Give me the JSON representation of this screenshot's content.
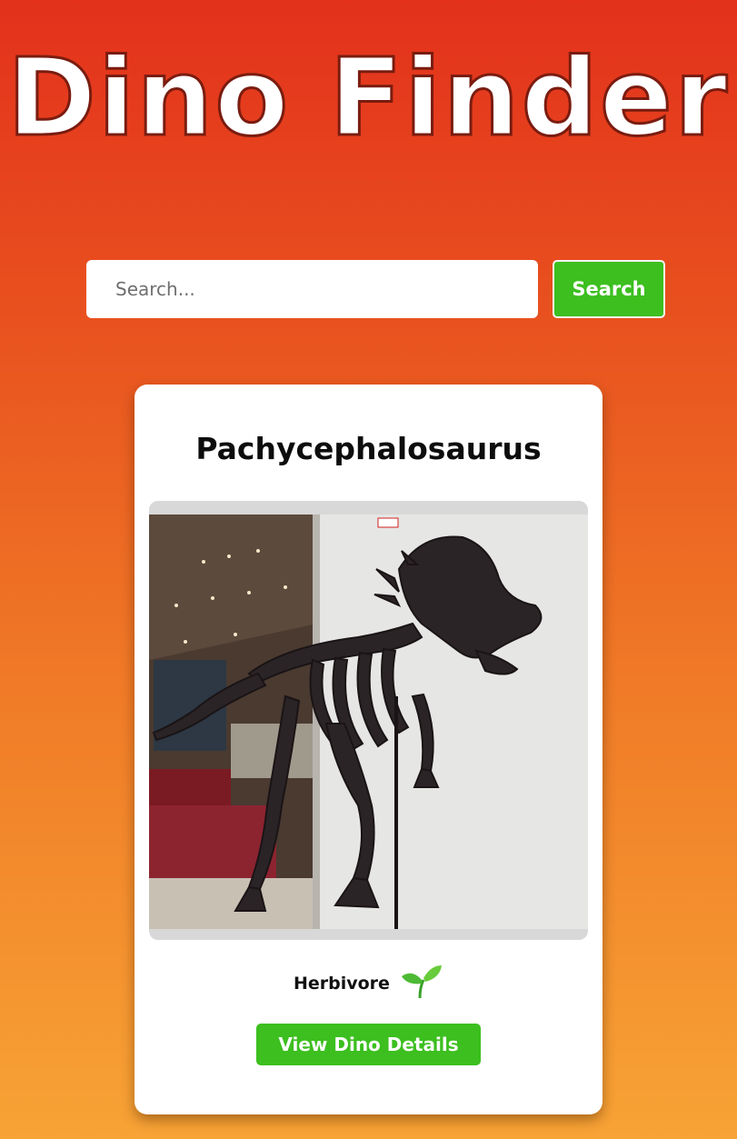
{
  "app": {
    "title": "Dino Finder"
  },
  "search": {
    "placeholder": "Search...",
    "button_label": "Search"
  },
  "card": {
    "name": "Pachycephalosaurus",
    "image_alt": "Pachycephalosaurus skeleton",
    "diet": "Herbivore",
    "diet_icon": "sprout-icon",
    "details_button_label": "View Dino Details"
  },
  "colors": {
    "background_top": "#e3311c",
    "background_bottom": "#f7a335",
    "accent_green": "#3cbf1f",
    "card_bg": "#ffffff"
  }
}
